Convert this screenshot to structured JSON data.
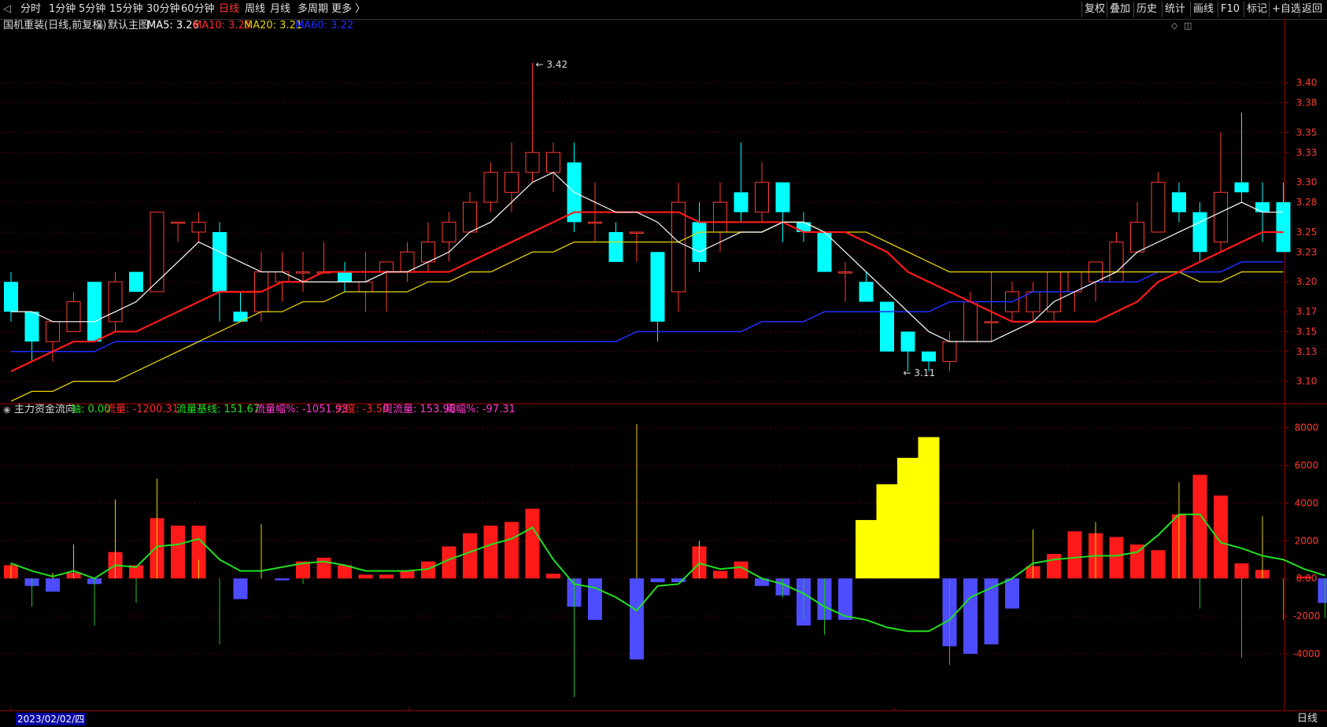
{
  "toolbar": {
    "periods": [
      "分时",
      "1分钟",
      "5分钟",
      "15分钟",
      "30分钟",
      "60分钟",
      "日线",
      "周线",
      "月线",
      "多周期",
      "更多 〉"
    ],
    "active_period": "日线",
    "right_buttons": [
      "复权",
      "叠加",
      "历史",
      "统计",
      "画线",
      "F10",
      "标记",
      "+自选",
      "返回"
    ]
  },
  "main_info": {
    "name": "国机重装(日线,前复权)",
    "template": "默认主图",
    "ma5": "MA5: 3.26",
    "ma10": "MA10: 3.25",
    "ma20": "MA20: 3.21",
    "ma60": "MA60: 3.22"
  },
  "indicator_info": {
    "name": "主力资金流向",
    "axis": "轴: 0.00",
    "flow": "流量: -1200.31",
    "base": "流量基线: 151.67",
    "flow_pct": "流量幅%: -1051.93",
    "force": "力度: -3.50",
    "week_flow": "周流量: 153.98",
    "week_pct": "周幅%: -97.31"
  },
  "colors": {
    "up": "#ff3b30",
    "down": "#00ffff",
    "ma5": "#ffffff",
    "ma10": "#ff1a1a",
    "ma20": "#e6d200",
    "ma60": "#2030ff",
    "flow_pos": "#ff1a1a",
    "flow_neg": "#4d4dff",
    "flow_big": "#ffff00",
    "baseline": "#20e020"
  },
  "annotations": {
    "high": "3.42",
    "low": "3.11"
  },
  "status": {
    "date": "2023/02/02/四",
    "period": "日线",
    "month_markers": [
      "2",
      "3",
      "4"
    ]
  },
  "chart_data": [
    {
      "type": "candlestick",
      "title": "国机重装(日线,前复权)",
      "y_ticks": [
        "3.40",
        "3.38",
        "3.35",
        "3.33",
        "3.30",
        "3.28",
        "3.25",
        "3.23",
        "3.20",
        "3.17",
        "3.15",
        "3.13",
        "3.10"
      ],
      "ylim": [
        3.08,
        3.45
      ],
      "candles": [
        {
          "o": 3.2,
          "h": 3.21,
          "l": 3.16,
          "c": 3.17
        },
        {
          "o": 3.17,
          "h": 3.17,
          "l": 3.12,
          "c": 3.14
        },
        {
          "o": 3.14,
          "h": 3.16,
          "l": 3.12,
          "c": 3.16
        },
        {
          "o": 3.15,
          "h": 3.19,
          "l": 3.15,
          "c": 3.18
        },
        {
          "o": 3.2,
          "h": 3.2,
          "l": 3.14,
          "c": 3.14
        },
        {
          "o": 3.16,
          "h": 3.21,
          "l": 3.15,
          "c": 3.2
        },
        {
          "o": 3.21,
          "h": 3.21,
          "l": 3.19,
          "c": 3.19
        },
        {
          "o": 3.19,
          "h": 3.27,
          "l": 3.19,
          "c": 3.27
        },
        {
          "o": 3.26,
          "h": 3.26,
          "l": 3.24,
          "c": 3.26
        },
        {
          "o": 3.25,
          "h": 3.27,
          "l": 3.24,
          "c": 3.26
        },
        {
          "o": 3.25,
          "h": 3.26,
          "l": 3.16,
          "c": 3.19
        },
        {
          "o": 3.17,
          "h": 3.19,
          "l": 3.16,
          "c": 3.16
        },
        {
          "o": 3.17,
          "h": 3.23,
          "l": 3.16,
          "c": 3.21
        },
        {
          "o": 3.2,
          "h": 3.23,
          "l": 3.18,
          "c": 3.21
        },
        {
          "o": 3.21,
          "h": 3.23,
          "l": 3.19,
          "c": 3.21
        },
        {
          "o": 3.21,
          "h": 3.24,
          "l": 3.21,
          "c": 3.21
        },
        {
          "o": 3.21,
          "h": 3.22,
          "l": 3.19,
          "c": 3.2
        },
        {
          "o": 3.19,
          "h": 3.23,
          "l": 3.17,
          "c": 3.2
        },
        {
          "o": 3.21,
          "h": 3.22,
          "l": 3.17,
          "c": 3.22
        },
        {
          "o": 3.21,
          "h": 3.24,
          "l": 3.2,
          "c": 3.23
        },
        {
          "o": 3.22,
          "h": 3.26,
          "l": 3.21,
          "c": 3.24
        },
        {
          "o": 3.24,
          "h": 3.27,
          "l": 3.22,
          "c": 3.26
        },
        {
          "o": 3.25,
          "h": 3.29,
          "l": 3.25,
          "c": 3.28
        },
        {
          "o": 3.28,
          "h": 3.32,
          "l": 3.27,
          "c": 3.31
        },
        {
          "o": 3.29,
          "h": 3.34,
          "l": 3.27,
          "c": 3.31
        },
        {
          "o": 3.31,
          "h": 3.42,
          "l": 3.3,
          "c": 3.33
        },
        {
          "o": 3.31,
          "h": 3.34,
          "l": 3.29,
          "c": 3.33
        },
        {
          "o": 3.32,
          "h": 3.34,
          "l": 3.25,
          "c": 3.26
        },
        {
          "o": 3.26,
          "h": 3.3,
          "l": 3.24,
          "c": 3.26
        },
        {
          "o": 3.25,
          "h": 3.26,
          "l": 3.22,
          "c": 3.22
        },
        {
          "o": 3.25,
          "h": 3.25,
          "l": 3.22,
          "c": 3.25
        },
        {
          "o": 3.23,
          "h": 3.23,
          "l": 3.14,
          "c": 3.16
        },
        {
          "o": 3.19,
          "h": 3.3,
          "l": 3.17,
          "c": 3.28
        },
        {
          "o": 3.26,
          "h": 3.28,
          "l": 3.21,
          "c": 3.22
        },
        {
          "o": 3.25,
          "h": 3.3,
          "l": 3.23,
          "c": 3.28
        },
        {
          "o": 3.29,
          "h": 3.34,
          "l": 3.26,
          "c": 3.27
        },
        {
          "o": 3.27,
          "h": 3.32,
          "l": 3.26,
          "c": 3.3
        },
        {
          "o": 3.3,
          "h": 3.3,
          "l": 3.24,
          "c": 3.27
        },
        {
          "o": 3.26,
          "h": 3.27,
          "l": 3.24,
          "c": 3.25
        },
        {
          "o": 3.25,
          "h": 3.25,
          "l": 3.21,
          "c": 3.21
        },
        {
          "o": 3.21,
          "h": 3.22,
          "l": 3.18,
          "c": 3.21
        },
        {
          "o": 3.2,
          "h": 3.21,
          "l": 3.18,
          "c": 3.18
        },
        {
          "o": 3.18,
          "h": 3.18,
          "l": 3.13,
          "c": 3.13
        },
        {
          "o": 3.15,
          "h": 3.15,
          "l": 3.11,
          "c": 3.13
        },
        {
          "o": 3.13,
          "h": 3.13,
          "l": 3.11,
          "c": 3.12
        },
        {
          "o": 3.12,
          "h": 3.15,
          "l": 3.11,
          "c": 3.14
        },
        {
          "o": 3.14,
          "h": 3.19,
          "l": 3.14,
          "c": 3.18
        },
        {
          "o": 3.16,
          "h": 3.21,
          "l": 3.14,
          "c": 3.16
        },
        {
          "o": 3.17,
          "h": 3.2,
          "l": 3.16,
          "c": 3.19
        },
        {
          "o": 3.17,
          "h": 3.2,
          "l": 3.16,
          "c": 3.19
        },
        {
          "o": 3.17,
          "h": 3.21,
          "l": 3.16,
          "c": 3.21
        },
        {
          "o": 3.19,
          "h": 3.21,
          "l": 3.17,
          "c": 3.21
        },
        {
          "o": 3.2,
          "h": 3.22,
          "l": 3.18,
          "c": 3.22
        },
        {
          "o": 3.2,
          "h": 3.25,
          "l": 3.2,
          "c": 3.24
        },
        {
          "o": 3.23,
          "h": 3.28,
          "l": 3.23,
          "c": 3.26
        },
        {
          "o": 3.25,
          "h": 3.31,
          "l": 3.25,
          "c": 3.3
        },
        {
          "o": 3.29,
          "h": 3.3,
          "l": 3.26,
          "c": 3.27
        },
        {
          "o": 3.27,
          "h": 3.28,
          "l": 3.22,
          "c": 3.23
        },
        {
          "o": 3.24,
          "h": 3.35,
          "l": 3.23,
          "c": 3.29
        },
        {
          "o": 3.3,
          "h": 3.37,
          "l": 3.28,
          "c": 3.29
        },
        {
          "o": 3.28,
          "h": 3.3,
          "l": 3.24,
          "c": 3.27
        },
        {
          "o": 3.28,
          "h": 3.3,
          "l": 3.23,
          "c": 3.23
        }
      ],
      "ma5": [
        3.17,
        3.17,
        3.16,
        3.16,
        3.16,
        3.17,
        3.18,
        3.2,
        3.22,
        3.24,
        3.23,
        3.22,
        3.21,
        3.21,
        3.2,
        3.2,
        3.2,
        3.2,
        3.21,
        3.21,
        3.22,
        3.23,
        3.25,
        3.26,
        3.28,
        3.3,
        3.31,
        3.29,
        3.28,
        3.27,
        3.27,
        3.26,
        3.24,
        3.23,
        3.24,
        3.25,
        3.25,
        3.26,
        3.26,
        3.25,
        3.23,
        3.21,
        3.19,
        3.17,
        3.15,
        3.14,
        3.14,
        3.14,
        3.15,
        3.16,
        3.18,
        3.19,
        3.2,
        3.21,
        3.23,
        3.24,
        3.25,
        3.26,
        3.27,
        3.28,
        3.27,
        3.27
      ],
      "ma10": [
        3.11,
        3.12,
        3.13,
        3.14,
        3.14,
        3.15,
        3.15,
        3.16,
        3.17,
        3.18,
        3.19,
        3.19,
        3.19,
        3.2,
        3.2,
        3.21,
        3.21,
        3.21,
        3.21,
        3.21,
        3.21,
        3.21,
        3.22,
        3.23,
        3.24,
        3.25,
        3.26,
        3.27,
        3.27,
        3.27,
        3.27,
        3.27,
        3.27,
        3.26,
        3.26,
        3.26,
        3.26,
        3.26,
        3.25,
        3.25,
        3.25,
        3.24,
        3.23,
        3.21,
        3.2,
        3.19,
        3.18,
        3.17,
        3.16,
        3.16,
        3.16,
        3.16,
        3.16,
        3.17,
        3.18,
        3.2,
        3.21,
        3.22,
        3.23,
        3.24,
        3.25,
        3.25
      ],
      "ma20": [
        3.08,
        3.09,
        3.09,
        3.1,
        3.1,
        3.1,
        3.11,
        3.12,
        3.13,
        3.14,
        3.15,
        3.16,
        3.17,
        3.17,
        3.18,
        3.18,
        3.19,
        3.19,
        3.19,
        3.19,
        3.2,
        3.2,
        3.21,
        3.21,
        3.22,
        3.23,
        3.23,
        3.24,
        3.24,
        3.24,
        3.24,
        3.24,
        3.24,
        3.25,
        3.25,
        3.25,
        3.25,
        3.26,
        3.26,
        3.25,
        3.25,
        3.25,
        3.24,
        3.23,
        3.22,
        3.21,
        3.21,
        3.21,
        3.21,
        3.21,
        3.21,
        3.21,
        3.21,
        3.21,
        3.21,
        3.21,
        3.21,
        3.2,
        3.2,
        3.21,
        3.21,
        3.21
      ],
      "ma60": [
        3.13,
        3.13,
        3.13,
        3.13,
        3.13,
        3.14,
        3.14,
        3.14,
        3.14,
        3.14,
        3.14,
        3.14,
        3.14,
        3.14,
        3.14,
        3.14,
        3.14,
        3.14,
        3.14,
        3.14,
        3.14,
        3.14,
        3.14,
        3.14,
        3.14,
        3.14,
        3.14,
        3.14,
        3.14,
        3.14,
        3.15,
        3.15,
        3.15,
        3.15,
        3.15,
        3.15,
        3.16,
        3.16,
        3.16,
        3.17,
        3.17,
        3.17,
        3.17,
        3.17,
        3.17,
        3.18,
        3.18,
        3.18,
        3.18,
        3.19,
        3.19,
        3.19,
        3.2,
        3.2,
        3.2,
        3.21,
        3.21,
        3.21,
        3.21,
        3.22,
        3.22,
        3.22
      ]
    },
    {
      "type": "bar",
      "title": "主力资金流向",
      "y_ticks": [
        "8000",
        "6000",
        "4000",
        "2000",
        "0.00",
        "-2000",
        "-4000"
      ],
      "ylim": [
        -6800,
        8400
      ],
      "bars": [
        700,
        -400,
        -700,
        300,
        -300,
        1400,
        700,
        3200,
        2800,
        2800,
        0,
        -1100,
        0,
        -100,
        900,
        1100,
        700,
        200,
        200,
        400,
        900,
        1700,
        2400,
        2800,
        3000,
        3700,
        250,
        -1500,
        -2200,
        0,
        -4300,
        -200,
        -200,
        1700,
        400,
        900,
        -400,
        -900,
        -2500,
        -2200,
        -2200,
        3100,
        5000,
        6400,
        7500,
        -3600,
        -4000,
        -3500,
        -1600,
        650,
        1300,
        2500,
        2400,
        2200,
        1800,
        1500,
        3400,
        5500,
        4400,
        800,
        450,
        0,
        100,
        -1300
      ],
      "big_flow": [
        0,
        0,
        0,
        0,
        0,
        0,
        0,
        0,
        0,
        0,
        0,
        0,
        0,
        0,
        0,
        0,
        0,
        0,
        0,
        0,
        0,
        0,
        0,
        0,
        0,
        0,
        0,
        0,
        0,
        0,
        0,
        0,
        0,
        0,
        0,
        0,
        0,
        0,
        0,
        0,
        0,
        1,
        1,
        1,
        1,
        0,
        0,
        0,
        0,
        0,
        0,
        0,
        0,
        0,
        0,
        0,
        0,
        0,
        0,
        0,
        0,
        0,
        0,
        0
      ],
      "spikes": [
        800,
        -1500,
        300,
        1800,
        -2500,
        4200,
        -1300,
        5300,
        0,
        1000,
        -3500,
        0,
        2900,
        0,
        -300,
        0,
        0,
        0,
        0,
        0,
        0,
        0,
        0,
        0,
        0,
        0,
        0,
        -6300,
        0,
        0,
        8200,
        0,
        0,
        2000,
        0,
        0,
        0,
        -1000,
        -2200,
        -3000,
        0,
        0,
        0,
        0,
        0,
        -4600,
        0,
        0,
        0,
        2600,
        0,
        0,
        3000,
        0,
        0,
        0,
        5100,
        -1600,
        0,
        -4200,
        3300,
        -2200,
        0,
        -2100
      ],
      "baseline": [
        800,
        400,
        100,
        400,
        0,
        700,
        600,
        1700,
        1800,
        2100,
        1000,
        400,
        400,
        600,
        800,
        900,
        700,
        400,
        400,
        400,
        500,
        1000,
        1400,
        1800,
        2100,
        2700,
        1000,
        -300,
        -500,
        -1000,
        -1700,
        -400,
        -300,
        800,
        500,
        600,
        0,
        -300,
        -800,
        -1500,
        -2000,
        -2200,
        -2600,
        -2800,
        -2800,
        -2200,
        -1000,
        -500,
        0,
        800,
        1000,
        1100,
        1200,
        1200,
        1400,
        2300,
        3400,
        3400,
        1900,
        1600,
        1200,
        1000,
        500,
        150
      ]
    }
  ]
}
